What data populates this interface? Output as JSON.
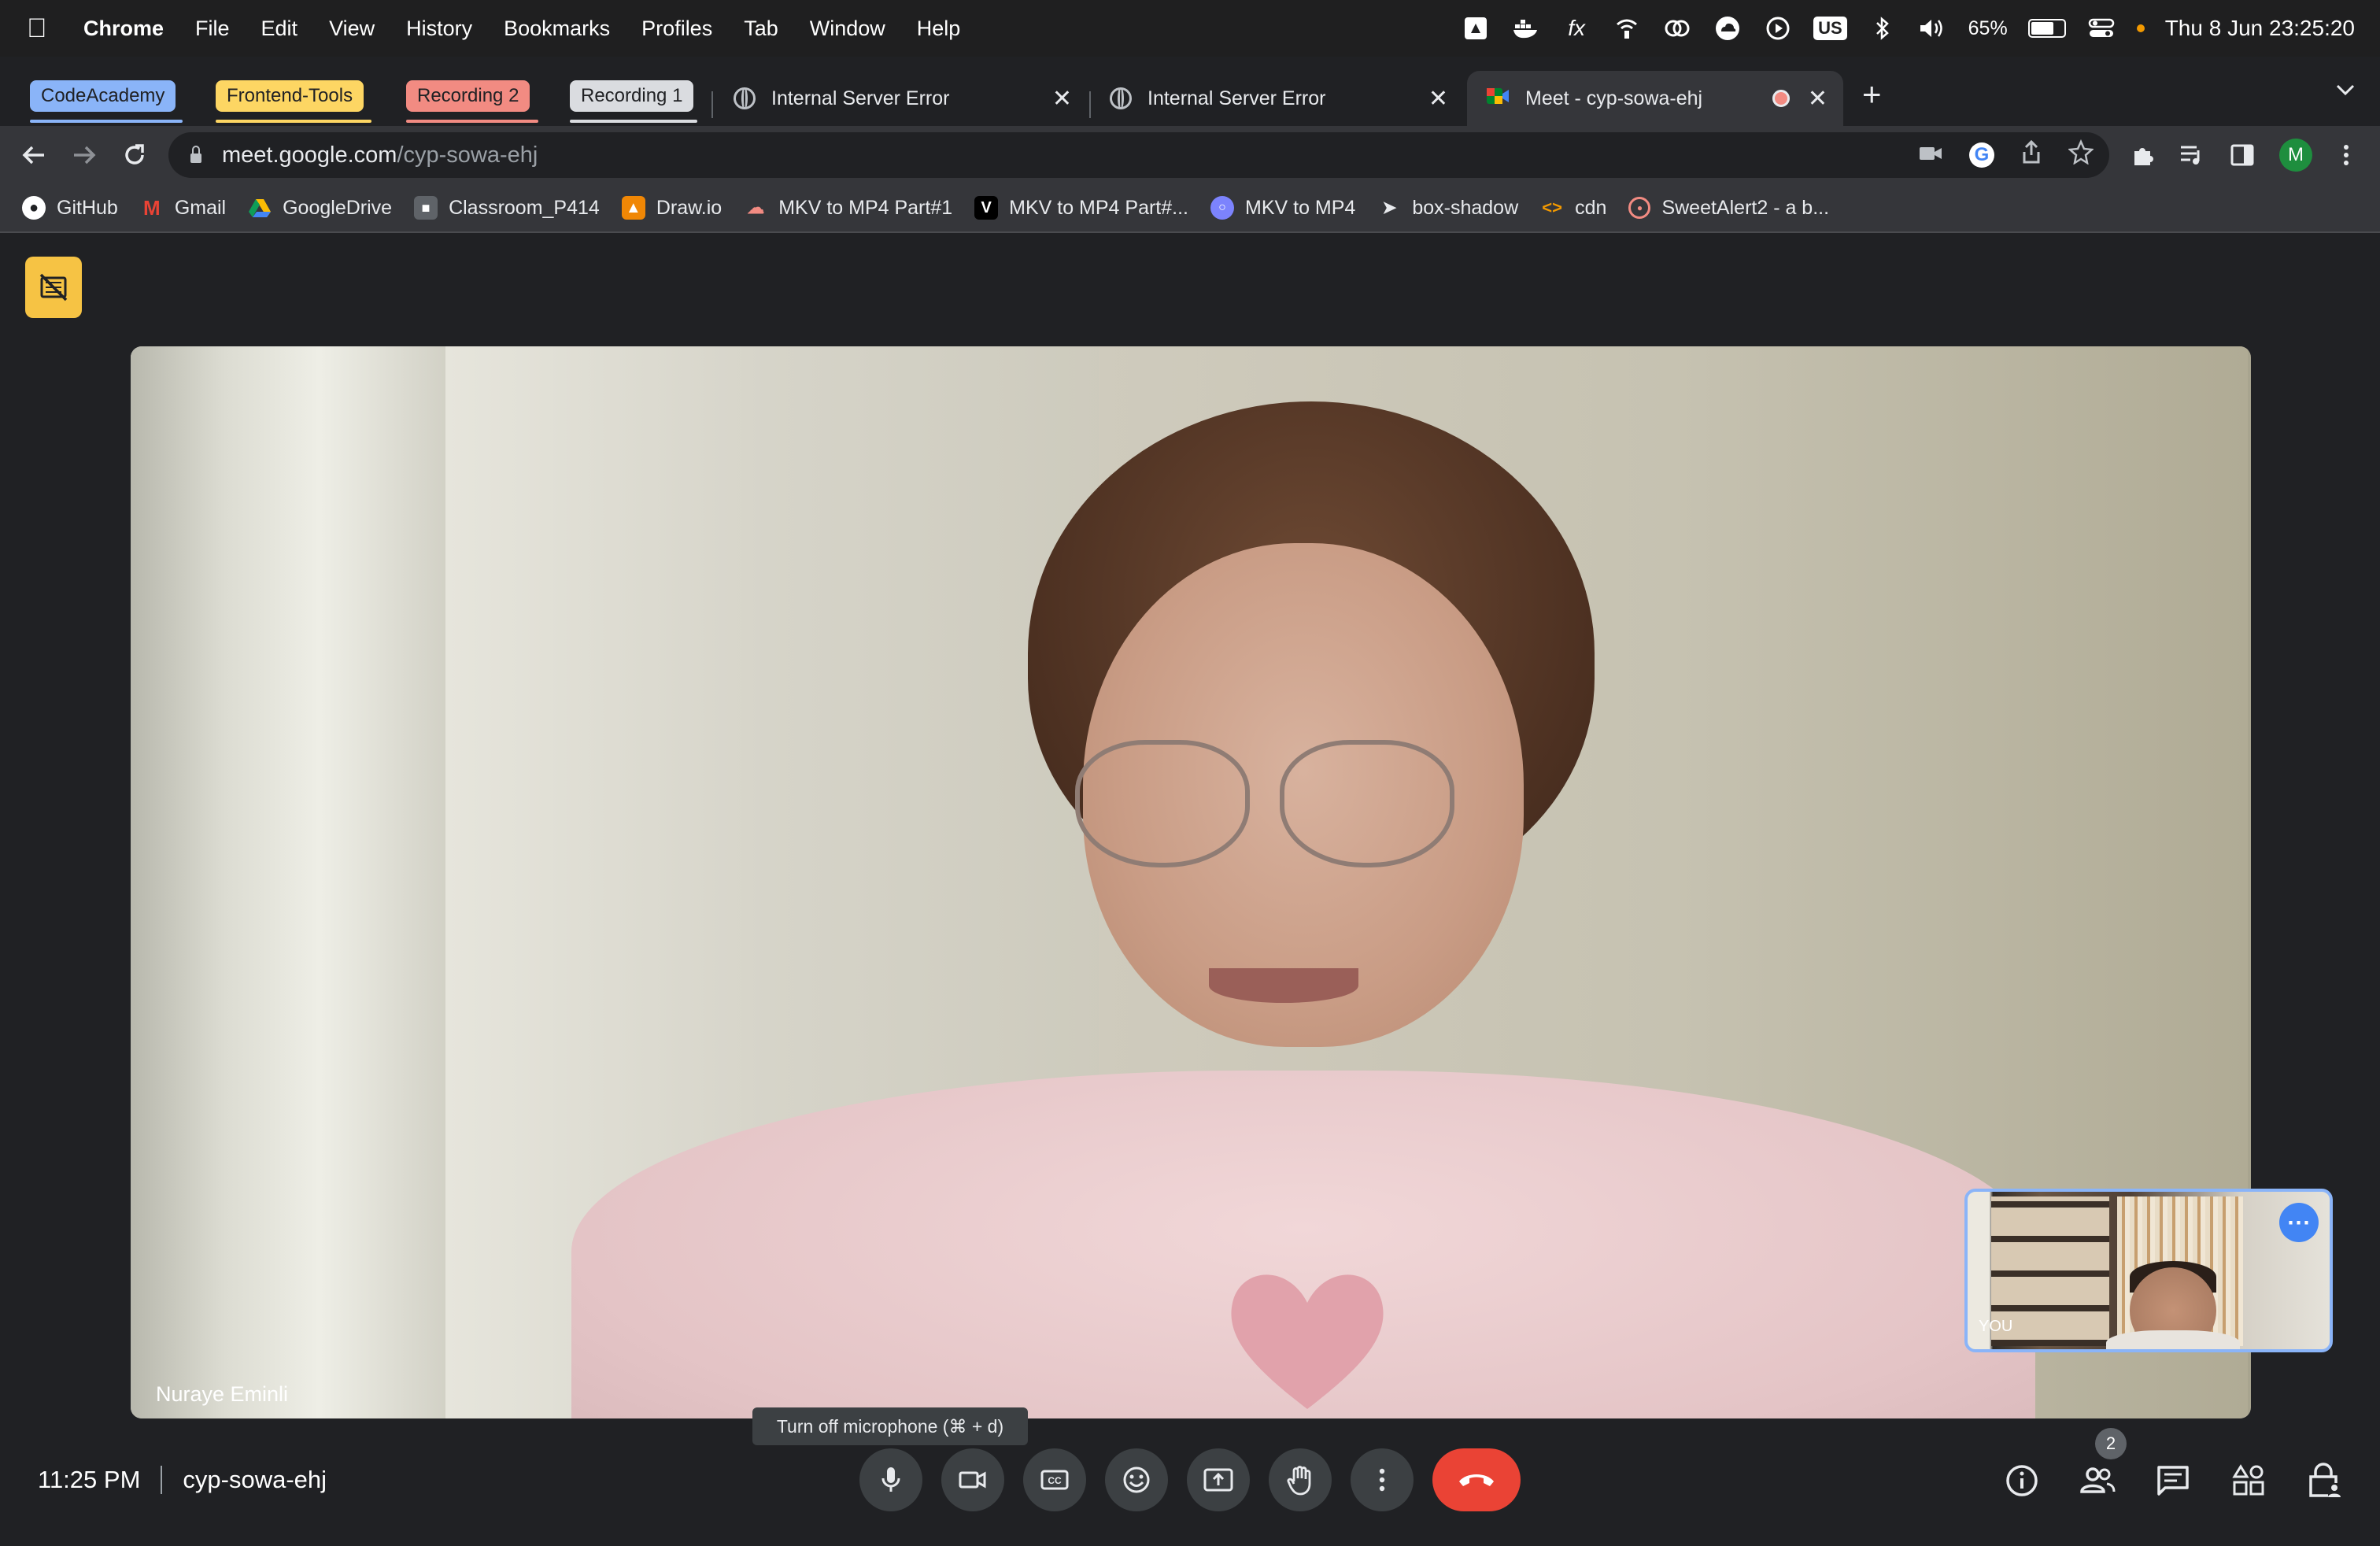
{
  "menubar": {
    "app_name": "Chrome",
    "items": [
      "File",
      "Edit",
      "View",
      "History",
      "Bookmarks",
      "Profiles",
      "Tab",
      "Window",
      "Help"
    ],
    "keyboard_layout": "US",
    "battery": "65%",
    "battery_level": 0.65,
    "datetime": "Thu 8 Jun  23:25:20"
  },
  "tab_groups": [
    {
      "label": "CodeAcademy",
      "color": "#8ab4f8"
    },
    {
      "label": "Frontend-Tools",
      "color": "#fdd663"
    },
    {
      "label": "Recording 2",
      "color": "#f28b82"
    },
    {
      "label": "Recording 1",
      "color": "#dadce0"
    }
  ],
  "tabs": [
    {
      "title": "Internal Server Error",
      "active": false
    },
    {
      "title": "Internal Server Error",
      "active": false
    },
    {
      "title": "Meet - cyp-sowa-ehj",
      "active": true
    }
  ],
  "address_bar": {
    "host": "meet.google.com",
    "path": "/cyp-sowa-ehj"
  },
  "profile_initial": "M",
  "bookmarks": [
    {
      "label": "GitHub",
      "icon": "github-icon"
    },
    {
      "label": "Gmail",
      "icon": "gmail-icon"
    },
    {
      "label": "GoogleDrive",
      "icon": "drive-icon"
    },
    {
      "label": "Classroom_P414",
      "icon": "classroom-icon"
    },
    {
      "label": "Draw.io",
      "icon": "drawio-icon"
    },
    {
      "label": "MKV to MP4 Part#1",
      "icon": "cloud-icon"
    },
    {
      "label": "MKV to MP4 Part#...",
      "icon": "v-icon"
    },
    {
      "label": "MKV to MP4",
      "icon": "circle-icon"
    },
    {
      "label": "box-shadow",
      "icon": "cursor-icon"
    },
    {
      "label": "cdn",
      "icon": "code-icon"
    },
    {
      "label": "SweetAlert2 - a b...",
      "icon": "sweetalert-icon"
    }
  ],
  "meet": {
    "participant_name": "Nuraye Eminli",
    "self_label": "YOU",
    "tooltip": "Turn off microphone (⌘ + d)",
    "time": "11:25 PM",
    "meeting_code": "cyp-sowa-ehj",
    "participants_count": "2"
  },
  "colors": {
    "end_call": "#ea4335",
    "accent": "#8ab4f8",
    "yellow_button": "#f6c344"
  }
}
